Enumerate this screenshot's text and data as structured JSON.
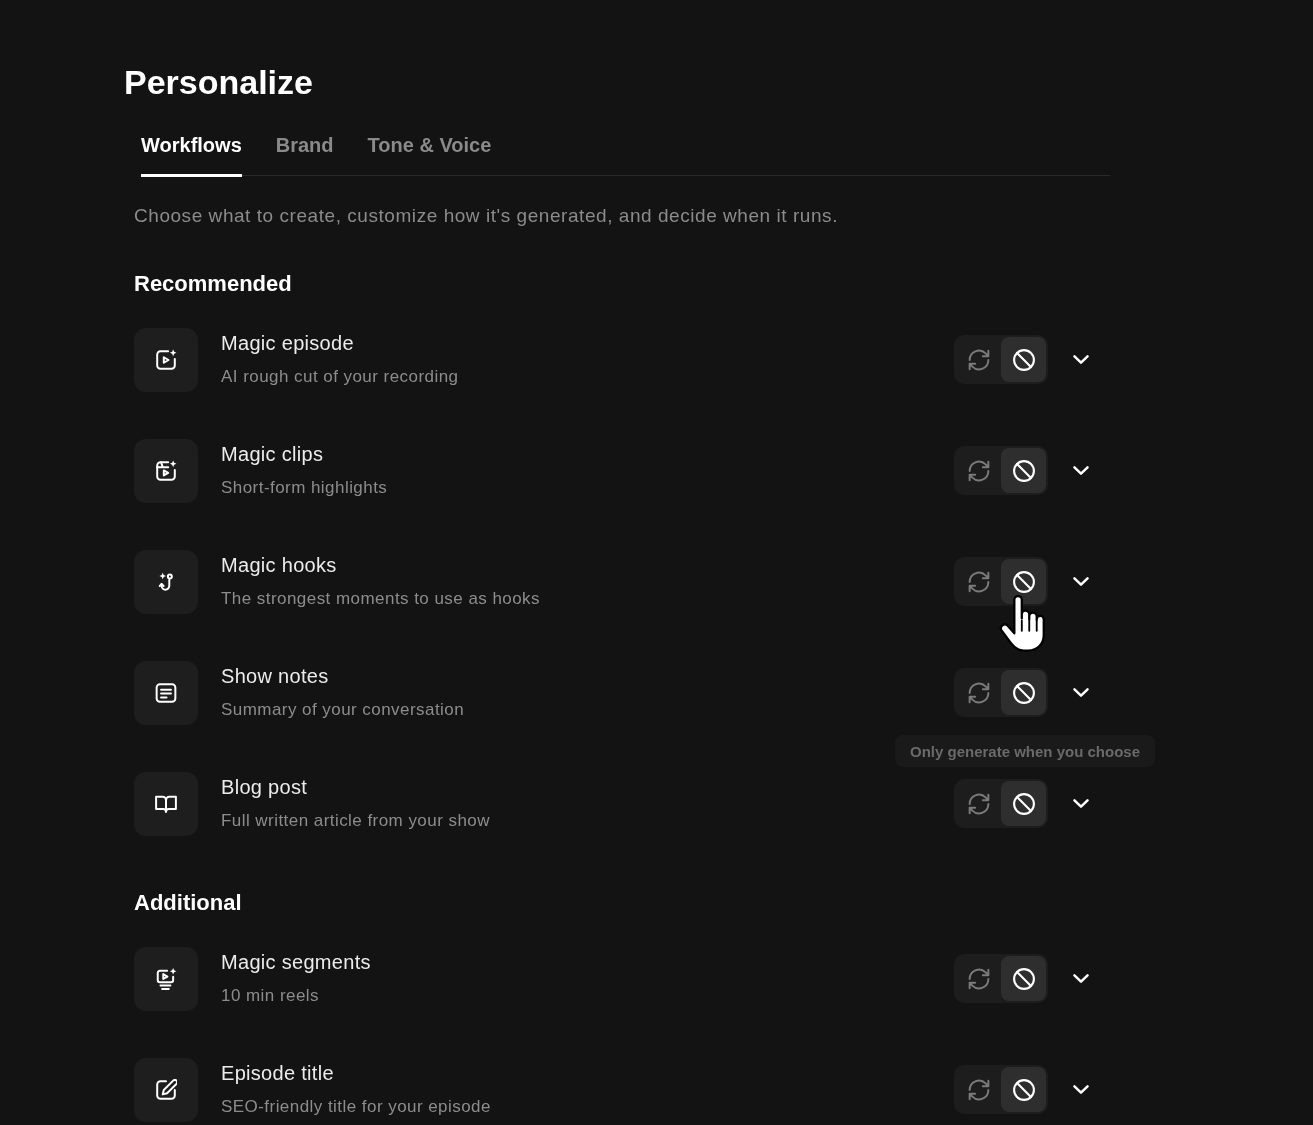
{
  "page": {
    "title": "Personalize"
  },
  "tabs": [
    {
      "label": "Workflows",
      "selected": true
    },
    {
      "label": "Brand",
      "selected": false
    },
    {
      "label": "Tone & Voice",
      "selected": false
    }
  ],
  "description": "Choose what to create, customize how it's generated, and decide when it runs.",
  "sections": [
    {
      "heading": "Recommended",
      "items": [
        {
          "title": "Magic episode",
          "subtitle": "AI rough cut of your recording",
          "manual_only": true,
          "expanded": false
        },
        {
          "title": "Magic clips",
          "subtitle": "Short-form highlights",
          "manual_only": true,
          "expanded": false
        },
        {
          "title": "Magic hooks",
          "subtitle": "The strongest moments to use as hooks",
          "manual_only": true,
          "expanded": false
        },
        {
          "title": "Show notes",
          "subtitle": "Summary of your conversation",
          "manual_only": true,
          "expanded": false,
          "tooltip": "Only generate when you choose"
        },
        {
          "title": "Blog post",
          "subtitle": "Full written article from your show",
          "manual_only": true,
          "expanded": false
        }
      ]
    },
    {
      "heading": "Additional",
      "items": [
        {
          "title": "Magic segments",
          "subtitle": "10 min reels",
          "manual_only": true,
          "expanded": false
        },
        {
          "title": "Episode title",
          "subtitle": "SEO-friendly title for your episode",
          "manual_only": true,
          "expanded": false
        }
      ]
    }
  ]
}
